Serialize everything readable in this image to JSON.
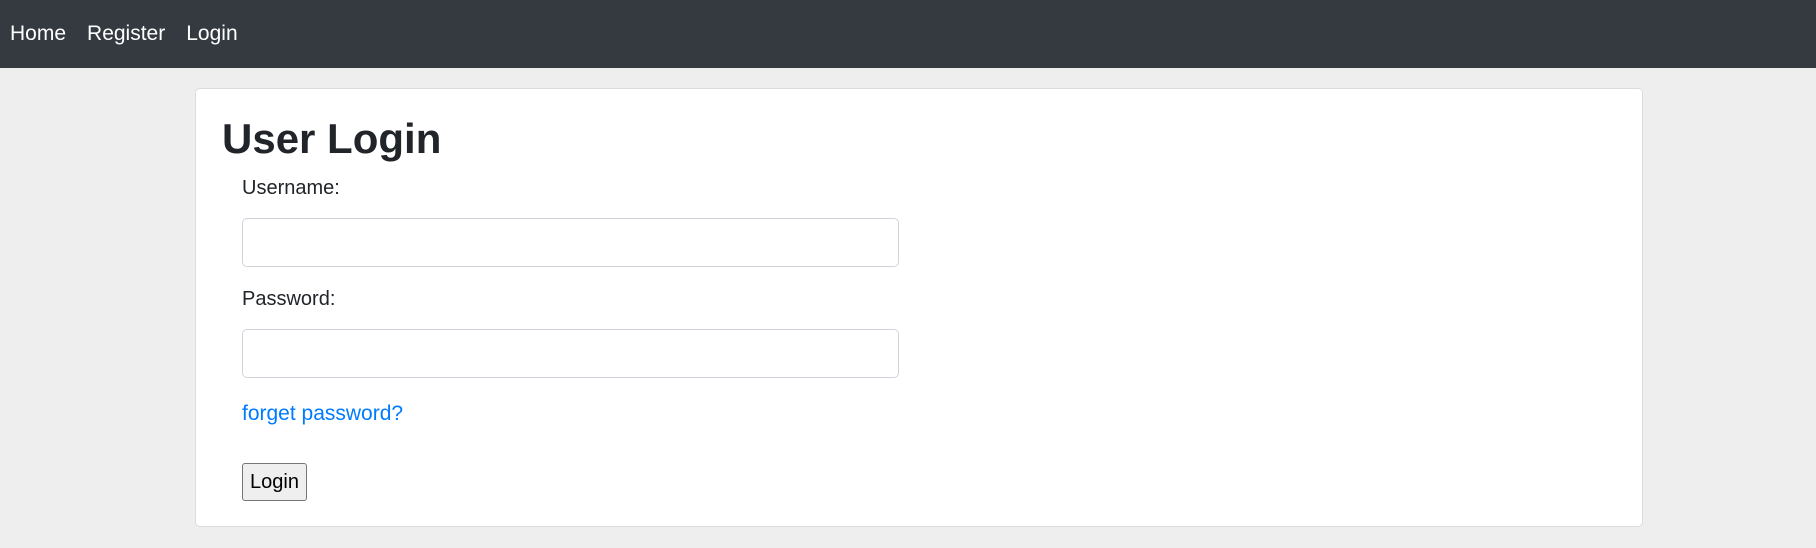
{
  "nav": {
    "items": [
      {
        "label": "Home"
      },
      {
        "label": "Register"
      },
      {
        "label": "Login"
      }
    ]
  },
  "login_form": {
    "title": "User Login",
    "username_label": "Username:",
    "username_value": "",
    "password_label": "Password:",
    "password_value": "",
    "forgot_link": "forget password?",
    "submit_label": "Login"
  },
  "colors": {
    "navbar_bg": "#343a40",
    "page_bg": "#eeeeee",
    "link": "#007bff"
  }
}
